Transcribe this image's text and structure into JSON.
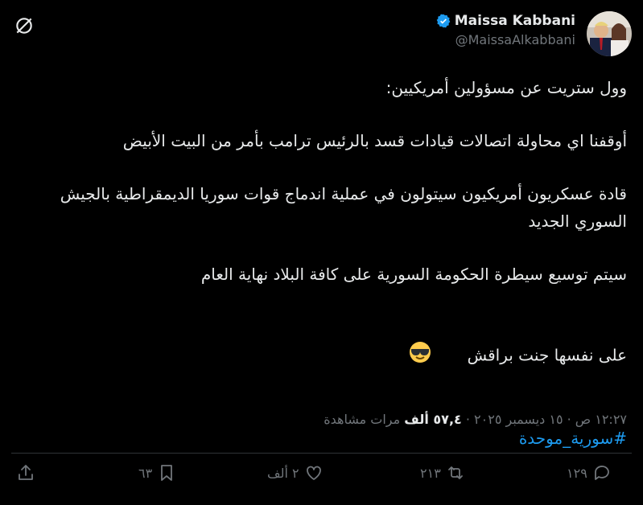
{
  "author": {
    "name": "Maissa Kabbani",
    "handle": "@MaissaAlkabbani",
    "verified": true
  },
  "tweet": {
    "paragraphs": [
      "وول ستريت عن مسؤولين أمريكيين:",
      "أوقفنا اي محاولة اتصالات قيادات قسد بالرئيس ترامب بأمر من البيت الأبيض",
      "قادة عسكريون أمريكيون سيتولون في عملية اندماج قوات سوريا الديمقراطية بالجيش السوري الجديد",
      "سيتم توسيع سيطرة الحكومة السورية على كافة البلاد نهاية العام",
      "على نفسها جنت براقش"
    ],
    "emoji": "😎",
    "hashtag": "#سورية_موحدة"
  },
  "meta": {
    "time_date": "١٢:٢٧ ص · ١٥ ديسمبر ٢٠٢٥ · ",
    "views_count": "٥٧,٤ ألف",
    "views_label": " مرات مشاهدة"
  },
  "actions": {
    "replies": "١٢٩",
    "reposts": "٢١٣",
    "likes": "٢ ألف",
    "bookmarks": "٦٣"
  },
  "colors": {
    "background": "#000000",
    "text": "#e7e9ea",
    "secondary": "#71767b",
    "accent": "#1d9bf0"
  },
  "icons": [
    "grok-icon",
    "verified-badge-icon",
    "reply-icon",
    "repost-icon",
    "like-icon",
    "bookmark-icon",
    "share-icon"
  ]
}
